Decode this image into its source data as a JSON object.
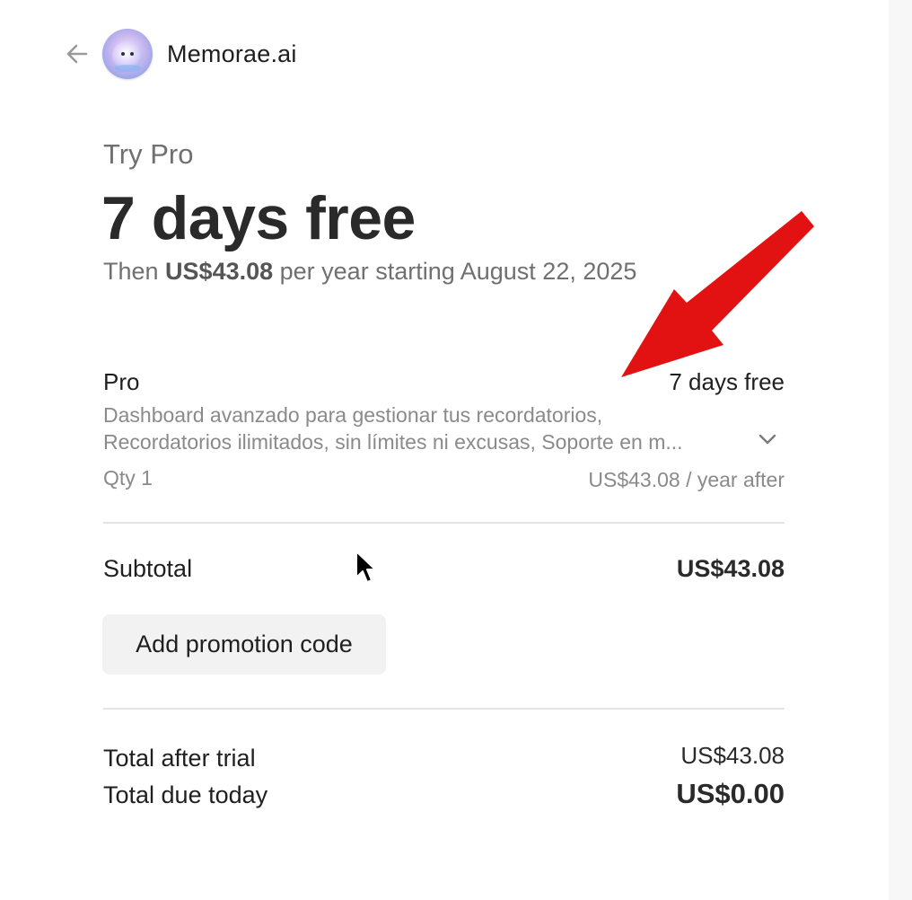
{
  "header": {
    "back_icon": "arrow-left-icon",
    "logo_icon": "memorae-mascot-avatar",
    "brand": "Memorae.ai"
  },
  "offer": {
    "label": "Try Pro",
    "headline": "7 days free",
    "subline_prefix": "Then ",
    "subline_price": "US$43.08",
    "subline_suffix": " per year starting August 22, 2025"
  },
  "line_item": {
    "name": "Pro",
    "price": "7 days free",
    "description_line1": "Dashboard avanzado para gestionar tus recordatorios,",
    "description_line2": "Recordatorios ilimitados, sin límites ni excusas, Soporte en m...",
    "expand_icon": "chevron-down-icon",
    "qty": "Qty 1",
    "after_price": "US$43.08 / year after"
  },
  "summary": {
    "subtotal_label": "Subtotal",
    "subtotal_value": "US$43.08",
    "promo_button": "Add promotion code",
    "total_after_trial_label": "Total after trial",
    "total_after_trial_value": "US$43.08",
    "total_due_label": "Total due today",
    "total_due_value": "US$0.00"
  },
  "annotation": {
    "arrow_icon": "red-arrow-annotation",
    "arrow_color": "#e31212"
  },
  "colors": {
    "text_primary": "#1f1f1f",
    "text_secondary": "#707070",
    "text_muted": "#8a8a8a",
    "divider": "#e3e3e3",
    "button_bg": "#f2f2f2"
  }
}
